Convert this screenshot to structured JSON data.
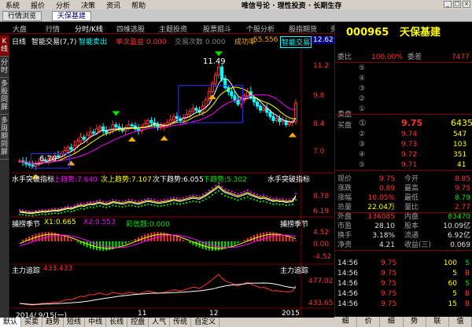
{
  "menu": {
    "items": [
      "系统",
      "报价",
      "分析",
      "决策",
      "资讯",
      "帮助"
    ],
    "slogan": "唯信号论 · 理性投资 · 长期生存"
  },
  "tabs": {
    "home": "行情浏览",
    "stock": "天保基建"
  },
  "nav": {
    "items": [
      "大盘",
      "行情",
      "分时/K线",
      "四维选股",
      "主题投资",
      "股票掘斗",
      "个股分析",
      "股指期货",
      "资讯"
    ]
  },
  "left_tabs": [
    "K线",
    "分时",
    "多股同屏",
    "多周期同屏"
  ],
  "main_panel": {
    "period": "日线",
    "indicator": "智能交易(7,7)",
    "smart_sell": "智能卖出",
    "single_profit": "单次盈益 0.000",
    "trade_count": "交易次数 0.000",
    "win_rate_label": "成功率",
    "win_rate": "55.556",
    "smart_trade": "智能交易",
    "price_box": "12.62",
    "high_label": "11.49",
    "low_label": "6.70",
    "y_ticks": [
      "11.2",
      "9.8",
      "8.4",
      "7.0"
    ]
  },
  "ind1": {
    "name": "水手突破指标",
    "up": "上趋势:7.640",
    "next_up": "次上趋势:7.107",
    "next_down": "次下趋势:6.055",
    "down": "下趋势:5.302",
    "name_right": "水手突破指标",
    "y_ticks": [
      "8.78",
      "6.19"
    ]
  },
  "ind2": {
    "name": "捕捞季节",
    "x1": "X1:0.665",
    "x2": "X2:0.553",
    "lights": "彩信鼓:0.000",
    "name_right": "捕捞季节",
    "y_ticks": [
      "4.52",
      "0.00",
      "-4.52"
    ]
  },
  "ind3": {
    "name": "主力追踪",
    "value": "433.433",
    "name_right": "主力追踪",
    "y_ticks": [
      "477.02",
      "433.65"
    ]
  },
  "xaxis": {
    "labels": [
      "2014/ 9/15(一)",
      "11",
      "12",
      "2015"
    ]
  },
  "bottom_tabs": [
    "默认",
    "买卖",
    "趋势",
    "短线",
    "中线",
    "长线",
    "控盘",
    "人气",
    "传统",
    "自定义"
  ],
  "quote": {
    "code": "000965",
    "name": "天保基建",
    "weibi_label": "委比",
    "weibi": "100.00%",
    "weicha_label": "委差",
    "weicha": "7477",
    "sell_label": "卖盘",
    "buy_label": "买盘",
    "sell_levels": [
      "⑤",
      "④",
      "③",
      "②",
      "①"
    ],
    "buy_levels": [
      {
        "lvl": "①",
        "price": "9.75",
        "vol": "6435"
      },
      {
        "lvl": "②",
        "price": "9.74",
        "vol": "547"
      },
      {
        "lvl": "③",
        "price": "9.73",
        "vol": "103"
      },
      {
        "lvl": "④",
        "price": "9.72",
        "vol": "351"
      },
      {
        "lvl": "⑤",
        "price": "9.71",
        "vol": "41"
      }
    ],
    "stats": [
      {
        "l1": "现价",
        "v1": "9.75",
        "l2": "今开",
        "v2": "8.85",
        "c1": "red",
        "c2": "red"
      },
      {
        "l1": "涨跌",
        "v1": "0.89",
        "l2": "最高",
        "v2": "9.75",
        "c1": "red",
        "c2": "red"
      },
      {
        "l1": "涨幅",
        "v1": "10.05%",
        "l2": "最低",
        "v2": "8.79",
        "c1": "red",
        "c2": "green"
      },
      {
        "l1": "总量",
        "v1": "22.04万",
        "l2": "量比",
        "v2": "2.77",
        "c1": "yellow",
        "c2": "red"
      },
      {
        "l1": "外盘",
        "v1": "136085",
        "l2": "内盘",
        "v2": "83470",
        "c1": "red",
        "c2": "green"
      },
      {
        "l1": "市盈",
        "v1": "28.10",
        "l2": "股本",
        "v2": "10.09亿",
        "c1": "white",
        "c2": "white"
      },
      {
        "l1": "换手",
        "v1": "3.18%",
        "l2": "流通",
        "v2": "6.92亿",
        "c1": "white",
        "c2": "white"
      },
      {
        "l1": "净资",
        "v1": "4.21",
        "l2": "收益(三)",
        "v2": "0.069",
        "c1": "white",
        "c2": "white"
      }
    ],
    "ticks": [
      {
        "t": "14:56",
        "p": "9.75",
        "v": "100",
        "s": "S"
      },
      {
        "t": "14:56",
        "p": "9.75",
        "v": "5",
        "s": "B"
      },
      {
        "t": "14:56",
        "p": "9.75",
        "v": "60",
        "s": "S"
      },
      {
        "t": "14:56",
        "p": "9.75",
        "v": "5",
        "s": "B"
      },
      {
        "t": "14:56",
        "p": "9.75",
        "v": "15",
        "s": "B"
      }
    ]
  },
  "right_bottom_tabs": [
    "细",
    "价",
    "细",
    "势",
    "联",
    "值"
  ],
  "chart_data": {
    "type": "candlestick",
    "period": "日线",
    "y_range": [
      6.6,
      12.3
    ],
    "annotated_high": 11.49,
    "annotated_low": 6.7,
    "last_price": 9.75,
    "closes": [
      6.95,
      6.9,
      6.8,
      6.75,
      6.7,
      6.85,
      6.9,
      7.0,
      6.95,
      7.05,
      7.1,
      7.2,
      7.15,
      7.3,
      7.45,
      7.6,
      7.5,
      7.7,
      7.9,
      8.1,
      8.0,
      8.2,
      8.35,
      8.3,
      8.5,
      8.6,
      8.4,
      8.3,
      8.45,
      8.7,
      8.6,
      8.5,
      8.4,
      8.55,
      8.7,
      8.65,
      8.5,
      8.4,
      8.6,
      8.75,
      8.9,
      8.8,
      8.7,
      8.55,
      8.6,
      8.7,
      8.8,
      8.95,
      9.1,
      9.0,
      8.9,
      9.05,
      9.2,
      9.35,
      9.5,
      9.4,
      9.3,
      9.6,
      9.9,
      10.3,
      10.7,
      11.1,
      11.49,
      10.9,
      10.5,
      10.3,
      10.1,
      9.9,
      9.7,
      9.9,
      10.1,
      10.3,
      10.0,
      9.8,
      9.6,
      9.4,
      9.5,
      9.3,
      9.1,
      8.9,
      9.0,
      8.85,
      8.9,
      8.7,
      8.8,
      8.86,
      9.75
    ]
  }
}
